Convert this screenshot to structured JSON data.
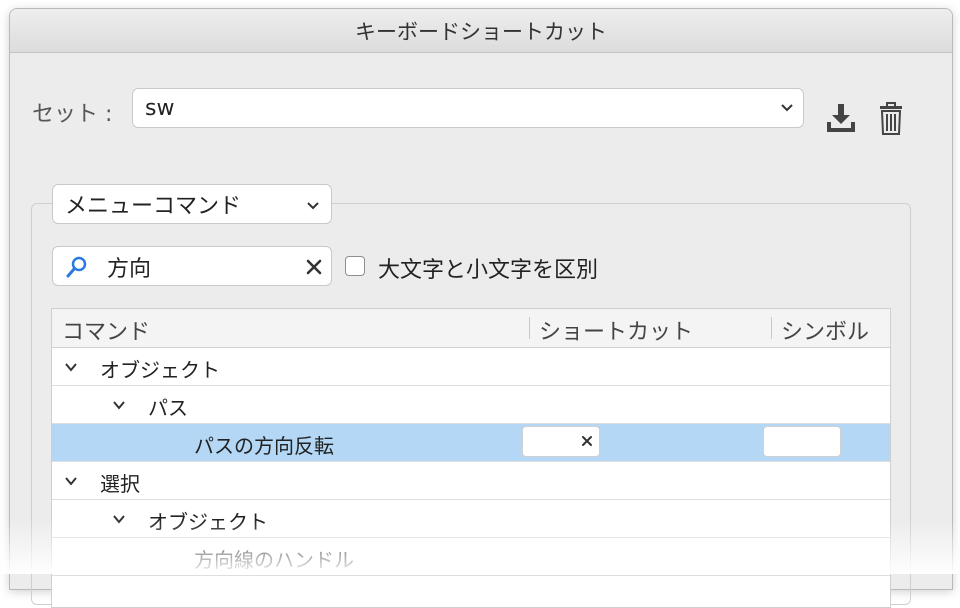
{
  "window": {
    "title": "キーボードショートカット"
  },
  "set": {
    "label": "セット :",
    "value": "sw"
  },
  "command_type": {
    "value": "メニューコマンド"
  },
  "search": {
    "value": "方向"
  },
  "case_option": {
    "label": "大文字と小文字を区別",
    "checked": false
  },
  "table": {
    "columns": [
      "コマンド",
      "ショートカット",
      "シンボル"
    ],
    "rows": [
      {
        "label": "オブジェクト",
        "level": 0,
        "expanded": true
      },
      {
        "label": "パス",
        "level": 1,
        "expanded": true
      },
      {
        "label": "パスの方向反転",
        "level": 2,
        "selected": true
      },
      {
        "label": "選択",
        "level": 0,
        "expanded": true
      },
      {
        "label": "オブジェクト",
        "level": 1,
        "expanded": true
      },
      {
        "label": "方向線のハンドル",
        "level": 2
      }
    ]
  },
  "icons": {
    "set_dropdown": "chevron-down-icon",
    "save_set": "download-icon",
    "delete_set": "trash-icon",
    "search": "search-icon",
    "clear": "close-icon",
    "disclosure": "chevron-down-icon"
  },
  "colors": {
    "selection": "#b3d7f5",
    "accent": "#2a7ae2"
  }
}
